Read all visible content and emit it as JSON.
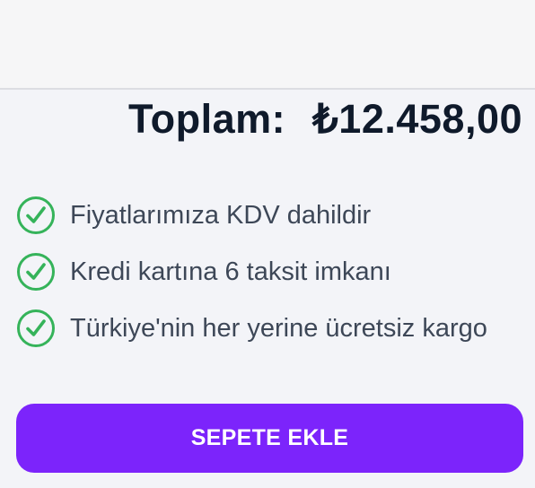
{
  "summary": {
    "total_label": "Toplam:",
    "total_value": "₺12.458,00"
  },
  "features": [
    {
      "icon": "check-circle-icon",
      "text": "Fiyatlarımıza KDV dahildir"
    },
    {
      "icon": "check-circle-icon",
      "text": "Kredi kartına 6 taksit imkanı"
    },
    {
      "icon": "check-circle-icon",
      "text": "Türkiye'nin her yerine ücretsiz kargo"
    }
  ],
  "cta": {
    "label": "SEPETE EKLE"
  },
  "colors": {
    "accent": "#7c24fb",
    "check": "#35b35a",
    "total_text": "#0f1a2b",
    "feature_text": "#3d4757"
  }
}
